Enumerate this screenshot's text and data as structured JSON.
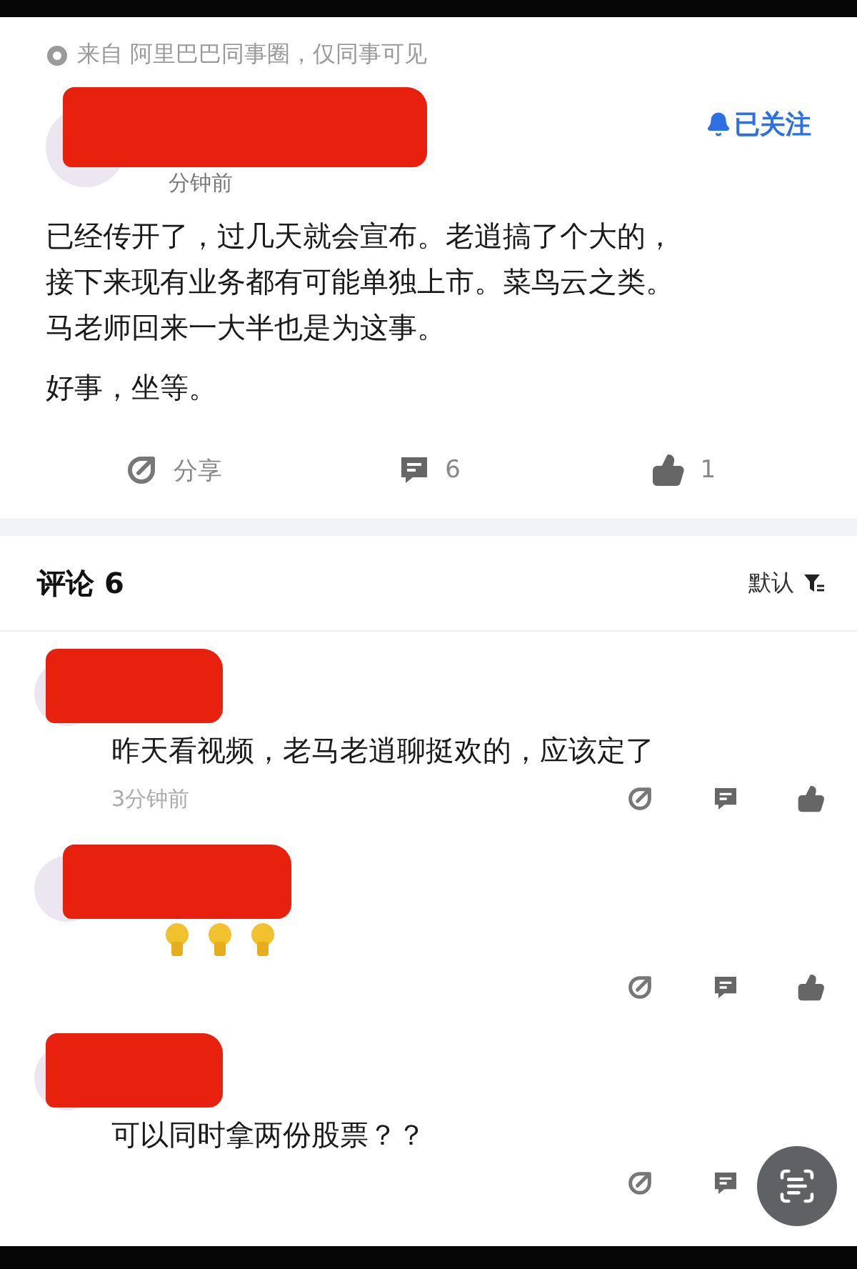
{
  "source_note": "来自 阿里巴巴同事圈，仅同事可见",
  "post": {
    "time": "分钟前",
    "follow": "已关注",
    "paragraphs": [
      [
        "已经传开了，过几天就会宣布。老逍搞了个大的，",
        "接下来现有业务都有可能单独上市。菜鸟云之类。",
        "马老师回来一大半也是为这事。"
      ],
      [
        "好事，坐等。"
      ]
    ],
    "actions": [
      {
        "kind": "share",
        "label": "分享"
      },
      {
        "kind": "comment",
        "label": "6"
      },
      {
        "kind": "like",
        "label": "1"
      }
    ]
  },
  "comments_header": {
    "title": "评论 6",
    "sort": "默认"
  },
  "comments": [
    {
      "kind": "text",
      "text": "昨天看视频，老马老逍聊挺欢的，应该定了",
      "time": "3分钟前",
      "actions": [
        {
          "kind": "share"
        },
        {
          "kind": "comment"
        },
        {
          "kind": "like"
        }
      ]
    },
    {
      "kind": "bulbs",
      "actions": [
        {
          "kind": "share"
        },
        {
          "kind": "comment"
        },
        {
          "kind": "like"
        }
      ]
    },
    {
      "kind": "text",
      "text": "可以同时拿两份股票？？",
      "actions": [
        {
          "kind": "share"
        },
        {
          "kind": "comment"
        }
      ]
    }
  ]
}
